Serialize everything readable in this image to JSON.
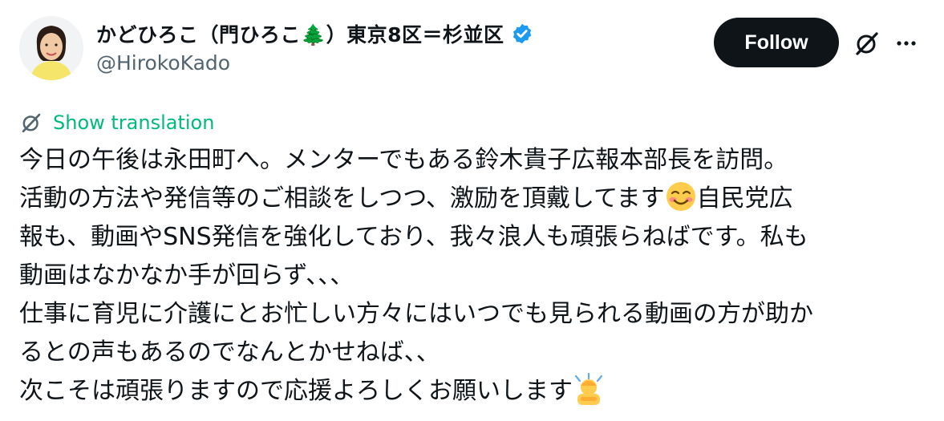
{
  "author": {
    "display_name": "かどひろこ（門ひろこ🌲）東京8区＝杉並区",
    "handle": "@HirokoKado",
    "verified": true
  },
  "actions": {
    "follow_label": "Follow"
  },
  "translation": {
    "label": "Show translation"
  },
  "tweet": {
    "lines": [
      {
        "text": "今日の午後は永田町へ。メンターでもある鈴木貴子広報本部長を訪問。",
        "after": ""
      },
      {
        "text": "活動の方法や発信等のご相談をしつつ、激励を頂戴してます",
        "emoji": "smiling-face-emoji",
        "after": "自民党広"
      },
      {
        "text": "報も、動画やSNS発信を強化しており、我々浪人も頑張らねばです。私も",
        "after": ""
      },
      {
        "text": "動画はなかなか手が回らず、、、",
        "after": ""
      },
      {
        "text": "仕事に育児に介護にとお忙しい方々にはいつでも見られる動画の方が助か",
        "after": ""
      },
      {
        "text": "るとの声もあるのでなんとかせねば、、",
        "after": ""
      },
      {
        "text": "次こそは頑張りますので応援よろしくお願いします",
        "emoji": "person-bowing-emoji",
        "after": ""
      }
    ]
  },
  "colors": {
    "follow_bg": "#0f1419",
    "verified": "#1d9bf0",
    "translation": "#00ba7c",
    "handle": "#536471"
  }
}
